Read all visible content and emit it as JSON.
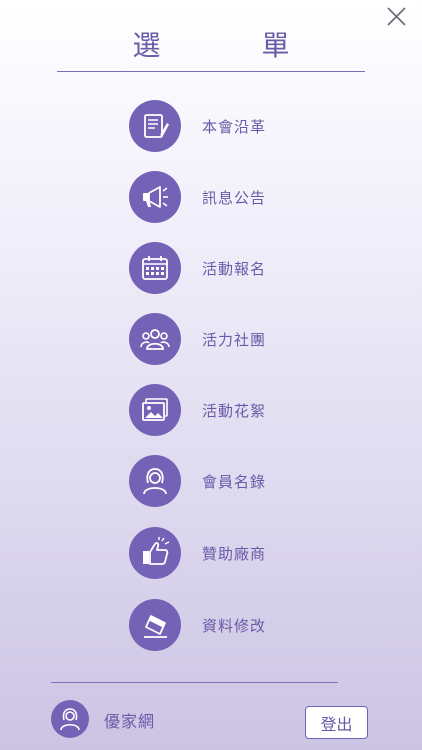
{
  "header": {
    "title": "選 單"
  },
  "menu": {
    "items": [
      {
        "label": "本會沿革",
        "icon": "history-document-icon"
      },
      {
        "label": "訊息公告",
        "icon": "megaphone-icon"
      },
      {
        "label": "活動報名",
        "icon": "calendar-icon"
      },
      {
        "label": "活力社團",
        "icon": "group-icon"
      },
      {
        "label": "活動花絮",
        "icon": "photo-gallery-icon"
      },
      {
        "label": "會員名錄",
        "icon": "member-icon"
      },
      {
        "label": "贊助廠商",
        "icon": "thumbs-up-icon"
      },
      {
        "label": "資料修改",
        "icon": "eraser-icon"
      }
    ]
  },
  "footer": {
    "username": "優家網",
    "logout_label": "登出"
  },
  "colors": {
    "accent": "#7462b6",
    "text": "#6a5aa8"
  }
}
